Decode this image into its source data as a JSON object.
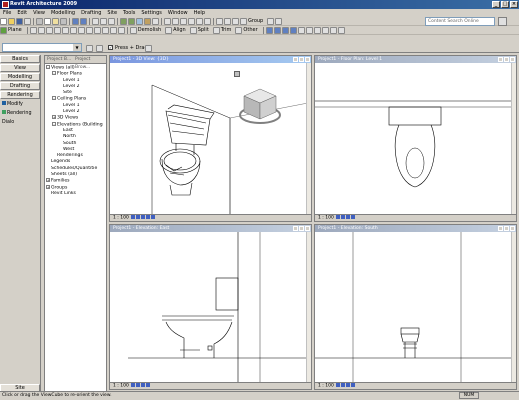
{
  "app": {
    "title": "Revit Architecture 2009"
  },
  "menu": [
    "File",
    "Edit",
    "View",
    "Modelling",
    "Drafting",
    "Site",
    "Tools",
    "Settings",
    "Window",
    "Help"
  ],
  "search": {
    "placeholder": "Content Search Online"
  },
  "toolbar2": {
    "plane_label": "Plane",
    "demolish_label": "Demolish",
    "align_label": "Align",
    "split_label": "Split",
    "trim_label": "Trim",
    "other_label": "Other",
    "group_label": "Group"
  },
  "toolbar4": {
    "press_drag_label": "Press + Drag"
  },
  "design_bar": {
    "tabs": [
      "Basics",
      "View",
      "Modelling",
      "Drafting",
      "Rendering"
    ],
    "items": [
      "Modify",
      "Rendering Dialo"
    ],
    "bottom_tab": "Site"
  },
  "browser": {
    "tabs": [
      "Project B...",
      "Project Brow..."
    ],
    "tree": [
      {
        "label": "Views (all)",
        "level": 0,
        "toggle": "-"
      },
      {
        "label": "Floor Plans",
        "level": 1,
        "toggle": "-"
      },
      {
        "label": "Level 1",
        "level": 2,
        "toggle": ""
      },
      {
        "label": "Level 2",
        "level": 2,
        "toggle": ""
      },
      {
        "label": "Site",
        "level": 2,
        "toggle": ""
      },
      {
        "label": "Ceiling Plans",
        "level": 1,
        "toggle": "-"
      },
      {
        "label": "Level 1",
        "level": 2,
        "toggle": ""
      },
      {
        "label": "Level 2",
        "level": 2,
        "toggle": ""
      },
      {
        "label": "3D Views",
        "level": 1,
        "toggle": "+"
      },
      {
        "label": "Elevations (Building",
        "level": 1,
        "toggle": "-"
      },
      {
        "label": "East",
        "level": 2,
        "toggle": ""
      },
      {
        "label": "North",
        "level": 2,
        "toggle": ""
      },
      {
        "label": "South",
        "level": 2,
        "toggle": ""
      },
      {
        "label": "West",
        "level": 2,
        "toggle": ""
      },
      {
        "label": "Renderings",
        "level": 1,
        "toggle": ""
      },
      {
        "label": "Legends",
        "level": 0,
        "toggle": ""
      },
      {
        "label": "Schedules/Quantitie",
        "level": 0,
        "toggle": ""
      },
      {
        "label": "Sheets (all)",
        "level": 0,
        "toggle": ""
      },
      {
        "label": "Families",
        "level": 0,
        "toggle": "+"
      },
      {
        "label": "Groups",
        "level": 0,
        "toggle": "+"
      },
      {
        "label": "Revit Links",
        "level": 0,
        "toggle": ""
      }
    ]
  },
  "views": {
    "v3d": {
      "title": "Project1 - 3D View: {3D}",
      "scale": "1 : 100"
    },
    "floor": {
      "title": "Project1 - Floor Plan: Level 1",
      "scale": "1 : 100"
    },
    "east": {
      "title": "Project1 - Elevation: East",
      "scale": "1 : 100"
    },
    "south": {
      "title": "Project1 - Elevation: South",
      "scale": "1 : 100"
    }
  },
  "status": {
    "message": "Click or drag the ViewCube to re-orient the view.",
    "num": "NUM"
  },
  "colors": {
    "title_active": "#7a96df",
    "title_inactive": "#9da9bd",
    "chrome": "#d4d0c8"
  }
}
